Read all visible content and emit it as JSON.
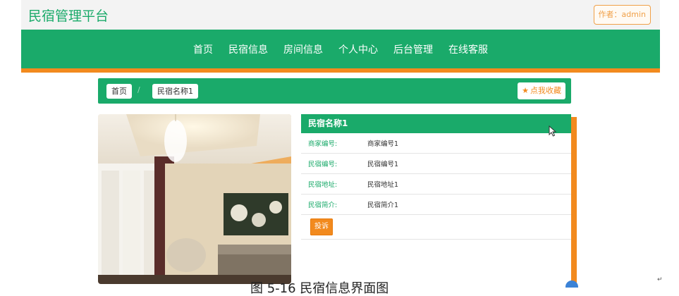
{
  "header": {
    "brand": "民宿管理平台",
    "author_badge": "作者：admin"
  },
  "nav": {
    "items": [
      "首页",
      "民宿信息",
      "房间信息",
      "个人中心",
      "后台管理",
      "在线客服"
    ]
  },
  "breadcrumb": {
    "home": "首页",
    "separator": "/",
    "current": "民宿名称1",
    "favorite_label": "点我收藏"
  },
  "detail": {
    "title": "民宿名称1",
    "fields": [
      {
        "label": "商家编号:",
        "value": "商家编号1"
      },
      {
        "label": "民宿编号:",
        "value": "民宿编号1"
      },
      {
        "label": "民宿地址:",
        "value": "民宿地址1"
      },
      {
        "label": "民宿简介:",
        "value": "民宿简介1"
      }
    ],
    "complain_button": "投诉"
  },
  "caption": "图 5-16 民宿信息界面图",
  "return_mark": "↵",
  "colors": {
    "green": "#1aaa6a",
    "orange": "#f28a1e",
    "topbar": "#f3f3f3"
  },
  "icons": {
    "favorite": "star-icon",
    "cursor": "mouse-pointer-icon"
  }
}
